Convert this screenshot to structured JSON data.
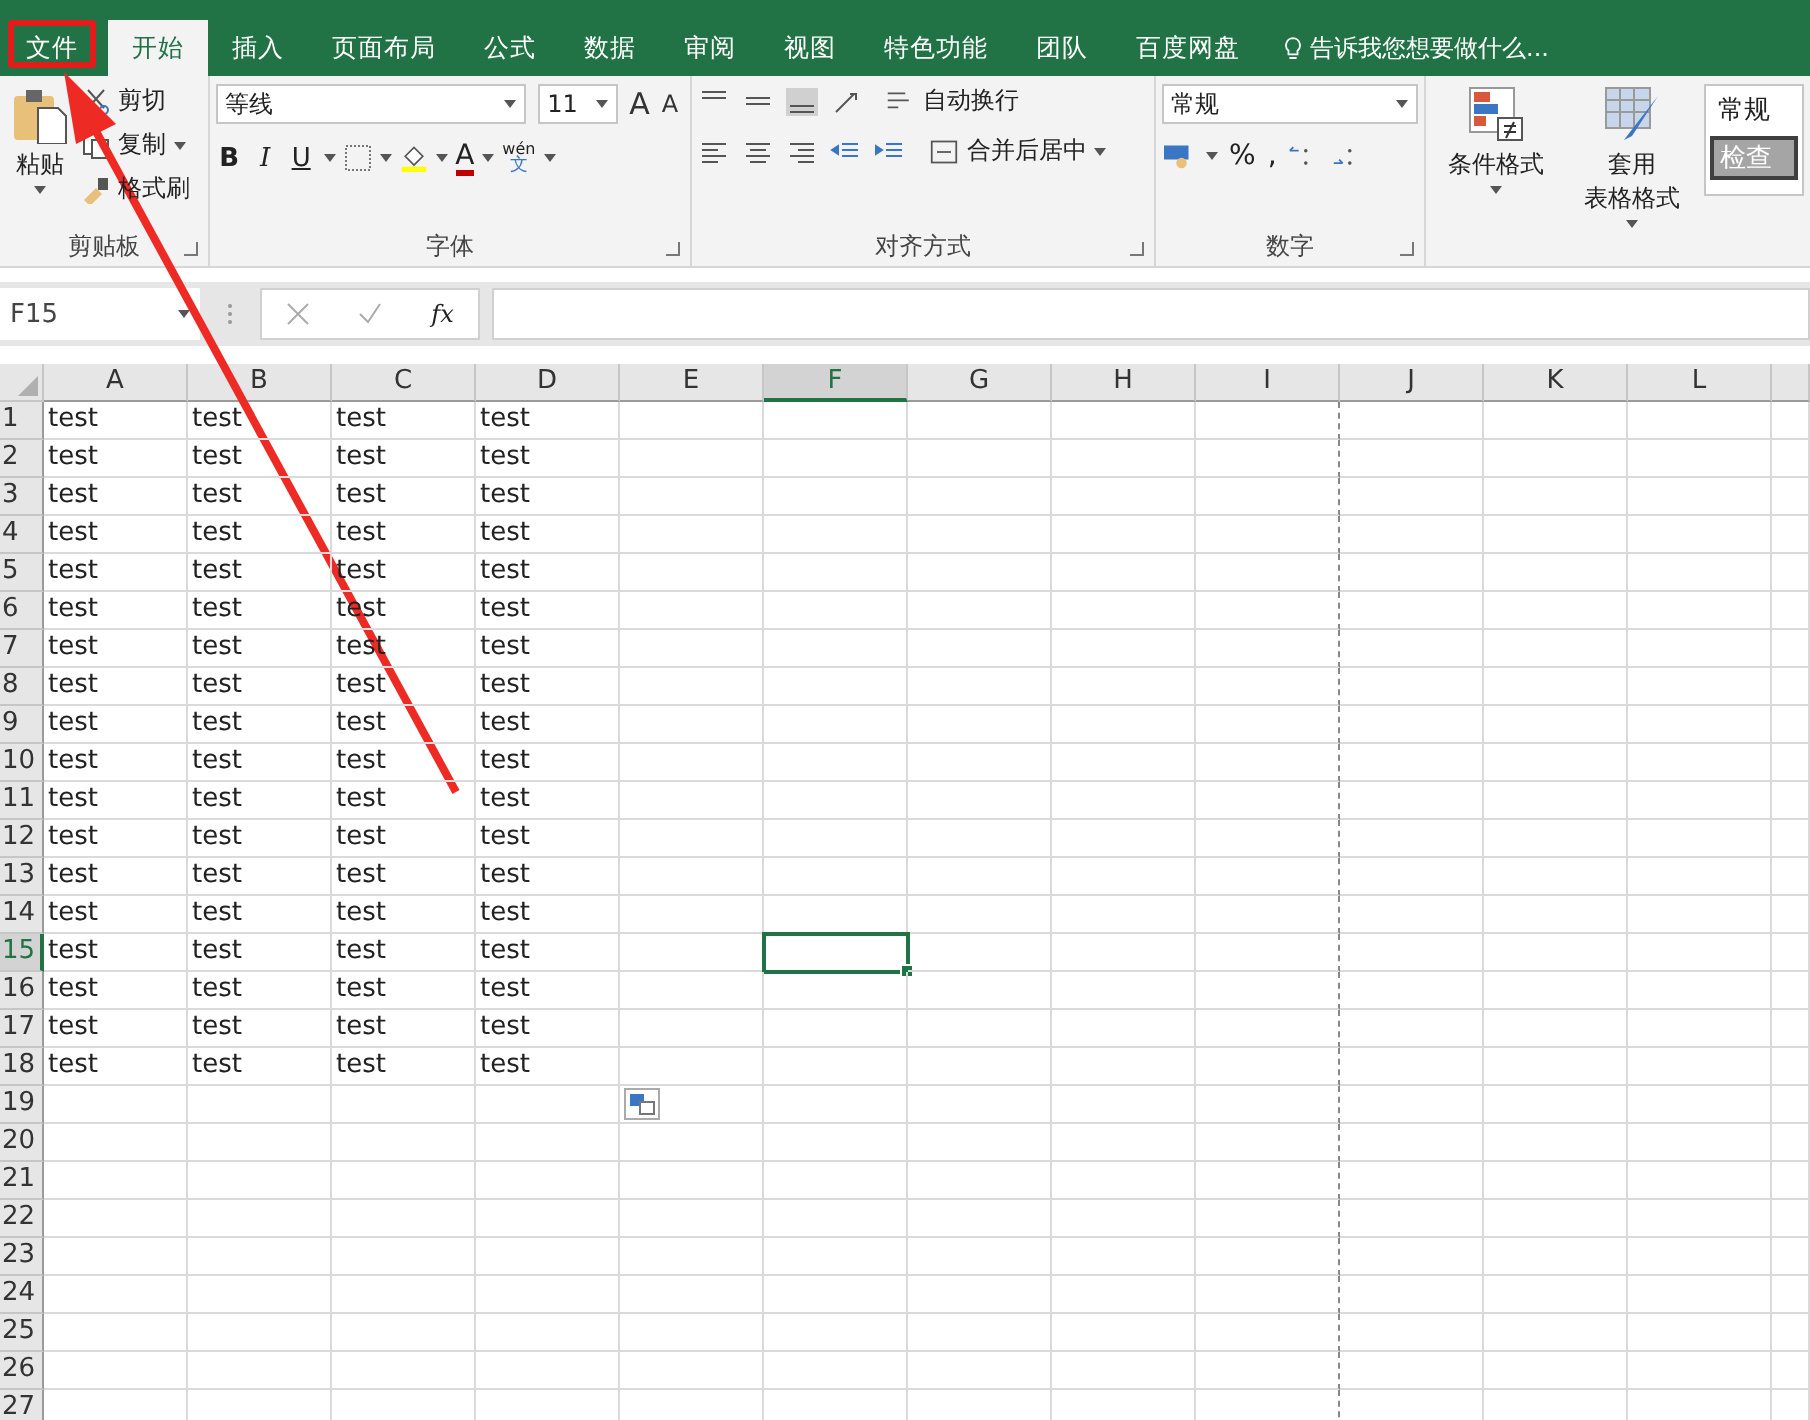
{
  "tabs": [
    {
      "label": "文件",
      "selected": false,
      "highlighted": true
    },
    {
      "label": "开始",
      "selected": true,
      "highlighted": false
    },
    {
      "label": "插入",
      "selected": false,
      "highlighted": false
    },
    {
      "label": "页面布局",
      "selected": false,
      "highlighted": false
    },
    {
      "label": "公式",
      "selected": false,
      "highlighted": false
    },
    {
      "label": "数据",
      "selected": false,
      "highlighted": false
    },
    {
      "label": "审阅",
      "selected": false,
      "highlighted": false
    },
    {
      "label": "视图",
      "selected": false,
      "highlighted": false
    },
    {
      "label": "特色功能",
      "selected": false,
      "highlighted": false
    },
    {
      "label": "团队",
      "selected": false,
      "highlighted": false
    },
    {
      "label": "百度网盘",
      "selected": false,
      "highlighted": false
    }
  ],
  "tell_me": "告诉我您想要做什么...",
  "clipboard": {
    "paste": "粘贴",
    "cut": "剪切",
    "copy": "复制",
    "format_painter": "格式刷",
    "label": "剪贴板"
  },
  "font": {
    "font_name": "等线",
    "font_size": "11",
    "grow": "A",
    "shrink": "A",
    "bold": "B",
    "italic": "I",
    "underline": "U",
    "font_color": "A",
    "phonetic_top": "wén",
    "phonetic_bottom": "文",
    "label": "字体"
  },
  "alignment": {
    "wrap_text": "自动换行",
    "merge_center": "合并后居中",
    "label": "对齐方式"
  },
  "number": {
    "format": "常规",
    "percent": "%",
    "comma": ",",
    "label": "数字"
  },
  "styles": {
    "conditional_formatting": "条件格式",
    "format_table_line1": "套用",
    "format_table_line2": "表格格式",
    "style_normal": "常规",
    "style_check": "检查"
  },
  "formula_bar": {
    "name_box": "F15",
    "fx": "fx"
  },
  "sheet": {
    "columns": [
      {
        "label": "A",
        "selected": false,
        "page_break": false
      },
      {
        "label": "B",
        "selected": false,
        "page_break": false
      },
      {
        "label": "C",
        "selected": false,
        "page_break": false
      },
      {
        "label": "D",
        "selected": false,
        "page_break": false
      },
      {
        "label": "E",
        "selected": false,
        "page_break": false
      },
      {
        "label": "F",
        "selected": true,
        "page_break": false
      },
      {
        "label": "G",
        "selected": false,
        "page_break": false
      },
      {
        "label": "H",
        "selected": false,
        "page_break": false
      },
      {
        "label": "I",
        "selected": false,
        "page_break": true
      },
      {
        "label": "J",
        "selected": false,
        "page_break": false
      },
      {
        "label": "K",
        "selected": false,
        "page_break": false
      },
      {
        "label": "L",
        "selected": false,
        "page_break": false
      }
    ],
    "rows": [
      {
        "label": "1",
        "selected": false,
        "cells": [
          "test",
          "test",
          "test",
          "test"
        ]
      },
      {
        "label": "2",
        "selected": false,
        "cells": [
          "test",
          "test",
          "test",
          "test"
        ]
      },
      {
        "label": "3",
        "selected": false,
        "cells": [
          "test",
          "test",
          "test",
          "test"
        ]
      },
      {
        "label": "4",
        "selected": false,
        "cells": [
          "test",
          "test",
          "test",
          "test"
        ]
      },
      {
        "label": "5",
        "selected": false,
        "cells": [
          "test",
          "test",
          "test",
          "test"
        ]
      },
      {
        "label": "6",
        "selected": false,
        "cells": [
          "test",
          "test",
          "test",
          "test"
        ]
      },
      {
        "label": "7",
        "selected": false,
        "cells": [
          "test",
          "test",
          "test",
          "test"
        ]
      },
      {
        "label": "8",
        "selected": false,
        "cells": [
          "test",
          "test",
          "test",
          "test"
        ]
      },
      {
        "label": "9",
        "selected": false,
        "cells": [
          "test",
          "test",
          "test",
          "test"
        ]
      },
      {
        "label": "10",
        "selected": false,
        "cells": [
          "test",
          "test",
          "test",
          "test"
        ]
      },
      {
        "label": "11",
        "selected": false,
        "cells": [
          "test",
          "test",
          "test",
          "test"
        ]
      },
      {
        "label": "12",
        "selected": false,
        "cells": [
          "test",
          "test",
          "test",
          "test"
        ]
      },
      {
        "label": "13",
        "selected": false,
        "cells": [
          "test",
          "test",
          "test",
          "test"
        ]
      },
      {
        "label": "14",
        "selected": false,
        "cells": [
          "test",
          "test",
          "test",
          "test"
        ]
      },
      {
        "label": "15",
        "selected": true,
        "cells": [
          "test",
          "test",
          "test",
          "test"
        ]
      },
      {
        "label": "16",
        "selected": false,
        "cells": [
          "test",
          "test",
          "test",
          "test"
        ]
      },
      {
        "label": "17",
        "selected": false,
        "cells": [
          "test",
          "test",
          "test",
          "test"
        ]
      },
      {
        "label": "18",
        "selected": false,
        "cells": [
          "test",
          "test",
          "test",
          "test"
        ]
      },
      {
        "label": "19",
        "selected": false,
        "cells": []
      },
      {
        "label": "20",
        "selected": false,
        "cells": []
      },
      {
        "label": "21",
        "selected": false,
        "cells": []
      },
      {
        "label": "22",
        "selected": false,
        "cells": []
      },
      {
        "label": "23",
        "selected": false,
        "cells": []
      },
      {
        "label": "24",
        "selected": false,
        "cells": []
      },
      {
        "label": "25",
        "selected": false,
        "cells": []
      },
      {
        "label": "26",
        "selected": false,
        "cells": []
      },
      {
        "label": "27",
        "selected": false,
        "cells": []
      }
    ]
  }
}
